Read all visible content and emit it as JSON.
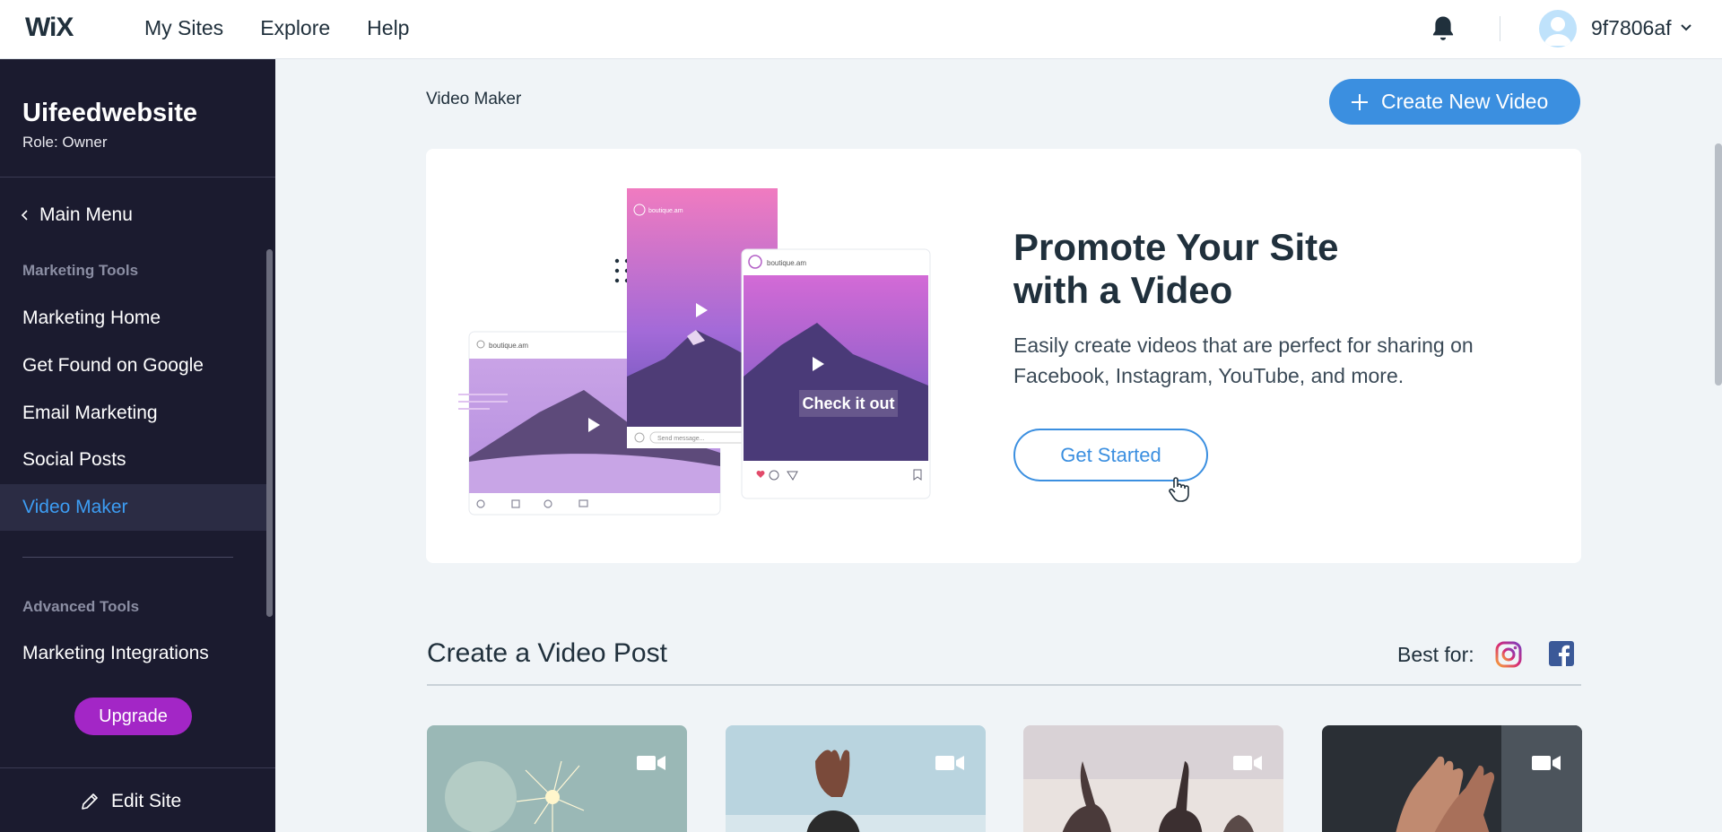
{
  "topbar": {
    "logo": "WiX",
    "nav": [
      "My Sites",
      "Explore",
      "Help"
    ],
    "username": "9f7806af"
  },
  "sidebar": {
    "site_name": "Uifeedwebsite",
    "role": "Role: Owner",
    "main_menu": "Main Menu",
    "section_marketing": "Marketing Tools",
    "items": [
      "Marketing Home",
      "Get Found on Google",
      "Email Marketing",
      "Social Posts",
      "Video Maker"
    ],
    "active_item": "Video Maker",
    "section_advanced": "Advanced Tools",
    "advanced_items": [
      "Marketing Integrations"
    ],
    "upgrade_label": "Upgrade",
    "edit_site_label": "Edit Site"
  },
  "main": {
    "breadcrumb": "Video Maker",
    "create_button": "Create New Video",
    "promo": {
      "title": "Promote Your Site\nwith a Video",
      "description": "Easily create videos that are perfect for sharing on Facebook, Instagram, YouTube, and more.",
      "cta": "Get Started",
      "illustration": {
        "handle_1": "boutique.am",
        "handle_2": "boutique.am",
        "handle_3": "boutique.am",
        "send_message": "Send message...",
        "overlay_text": "Check it out"
      }
    },
    "post_section": {
      "title": "Create a Video Post",
      "best_for_label": "Best for:",
      "platform_icons": [
        "instagram-icon",
        "facebook-icon"
      ]
    },
    "cards": [
      "sparkler",
      "yoga",
      "celebration",
      "hands"
    ]
  },
  "colors": {
    "sidebar_bg": "#1b1b2f",
    "accent_blue": "#3b8fe0",
    "active_text": "#3d9df3",
    "upgrade_purple": "#a326c6"
  }
}
